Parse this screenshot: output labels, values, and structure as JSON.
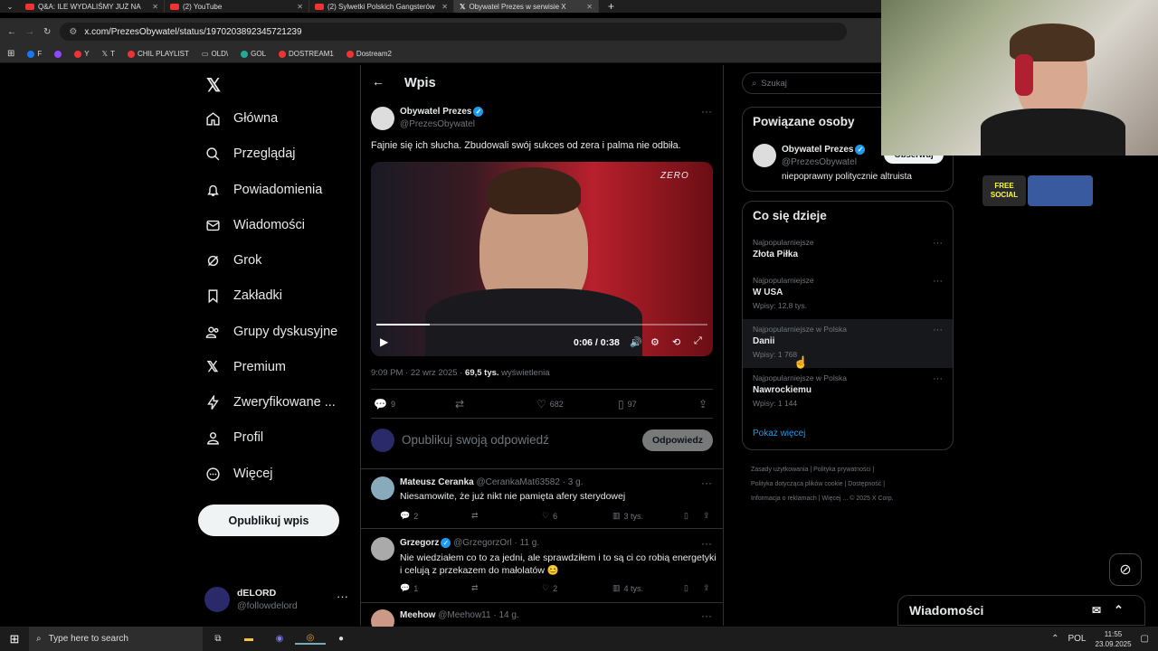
{
  "browser": {
    "tabs": [
      {
        "label": "Q&A: ILE WYDALIŚMY JUŻ NA"
      },
      {
        "label": "(2) YouTube"
      },
      {
        "label": "(2) Sylwetki Polskich Gangsterów"
      },
      {
        "label": "Obywatel Prezes w serwisie X"
      }
    ],
    "url": "x.com/PrezesObywatel/status/1970203892345721239",
    "bookmarks": [
      "F",
      "Y",
      "T",
      "CHIL PLAYLIST",
      "OLD\\",
      "GOL",
      "DOSTREAM1",
      "Dostream2"
    ]
  },
  "nav": {
    "items": [
      {
        "label": "Główna",
        "icon": "home-icon"
      },
      {
        "label": "Przeglądaj",
        "icon": "search-icon"
      },
      {
        "label": "Powiadomienia",
        "icon": "bell-icon"
      },
      {
        "label": "Wiadomości",
        "icon": "envelope-icon"
      },
      {
        "label": "Grok",
        "icon": "grok-icon"
      },
      {
        "label": "Zakładki",
        "icon": "bookmark-icon"
      },
      {
        "label": "Grupy dyskusyjne",
        "icon": "people-icon"
      },
      {
        "label": "Premium",
        "icon": "x-icon"
      },
      {
        "label": "Zweryfikowane ...",
        "icon": "lightning-icon"
      },
      {
        "label": "Profil",
        "icon": "person-icon"
      },
      {
        "label": "Więcej",
        "icon": "more-circle-icon"
      }
    ],
    "post_button": "Opublikuj wpis",
    "account": {
      "name": "dELORD",
      "handle": "@followdelord"
    }
  },
  "main": {
    "header": "Wpis",
    "post": {
      "author": "Obywatel Prezes",
      "handle": "@PrezesObywatel",
      "text": "Fajnie się ich słucha. Zbudowali swój sukces od zera i palma nie odbiła.",
      "video": {
        "time": "0:06 / 0:38",
        "watermark": "ZERO",
        "progress": 0.16
      },
      "time": "9:09 PM · 22 wrz 2025 · ",
      "views": "69,5 tys.",
      "views_label": " wyświetlenia",
      "replies": "9",
      "likes": "682",
      "bookmarks": "97"
    },
    "reply_box": {
      "placeholder": "Opublikuj swoją odpowiedź",
      "button": "Odpowiedz"
    },
    "replies": [
      {
        "name": "Mateusz Ceranka",
        "handle": "@CerankaMat63582 · 3 g.",
        "text": "Niesamowite, że już nikt nie pamięta afery sterydowej",
        "replies": "2",
        "likes": "6",
        "views": "3 tys."
      },
      {
        "name": "Grzegorz",
        "handle": "@GrzegorzOrl · 11 g.",
        "text": "Nie wiedziałem co to za jedni, ale sprawdziłem i to są ci co robią energetyki i celują z przekazem do małolatów 😊",
        "replies": "1",
        "likes": "2",
        "views": "4 tys."
      },
      {
        "name": "Meehow",
        "handle": "@Meehow11 · 14 g."
      }
    ]
  },
  "sidebar": {
    "search_placeholder": "Szukaj",
    "related_title": "Powiązane osoby",
    "related": {
      "name": "Obywatel Prezes",
      "handle": "@PrezesObywatel",
      "bio": "niepoprawny politycznie altruista",
      "follow": "Obserwuj"
    },
    "trends_title": "Co się dzieje",
    "trends": [
      {
        "category": "Najpopularniejsze",
        "title": "Złota Piłka",
        "count": ""
      },
      {
        "category": "Najpopularniejsze",
        "title": "W USA",
        "count": "Wpisy: 12,8 tys."
      },
      {
        "category": "Najpopularniejsze w Polska",
        "title": "Danii",
        "count": "Wpisy: 1 768"
      },
      {
        "category": "Najpopularniejsze w Polska",
        "title": "Nawrockiemu",
        "count": "Wpisy: 1 144"
      }
    ],
    "show_more": "Pokaż więcej",
    "footer": [
      "Zasady użytkowania",
      "Polityka prywatności",
      "Polityka dotycząca plików cookie",
      "Dostępność",
      "Informacja o reklamach",
      "Więcej ...",
      "© 2025 X Corp."
    ]
  },
  "messages_bar": "Wiadomości",
  "overlay_badge": "FREE SOCIAL",
  "taskbar": {
    "search": "Type here to search",
    "lang": "POL",
    "time": "11:55",
    "date": "23.09.2025"
  }
}
